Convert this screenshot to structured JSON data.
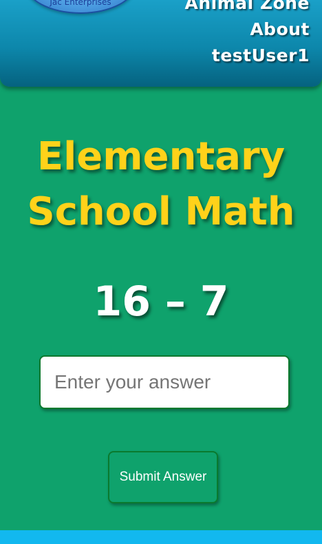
{
  "header": {
    "logo_text": "Jac Enterprises",
    "nav": [
      {
        "label": "Animal Zone"
      },
      {
        "label": "About"
      },
      {
        "label": "testUser1"
      }
    ]
  },
  "main": {
    "title_line1": "Elementary",
    "title_line2": "School Math",
    "problem": "16 – 7",
    "answer_placeholder": "Enter your answer",
    "submit_label": "Submit Answer"
  },
  "colors": {
    "background": "#0fa26c",
    "header": "#0d87ab",
    "title": "#ffd21a",
    "footer": "#12b8ef"
  }
}
